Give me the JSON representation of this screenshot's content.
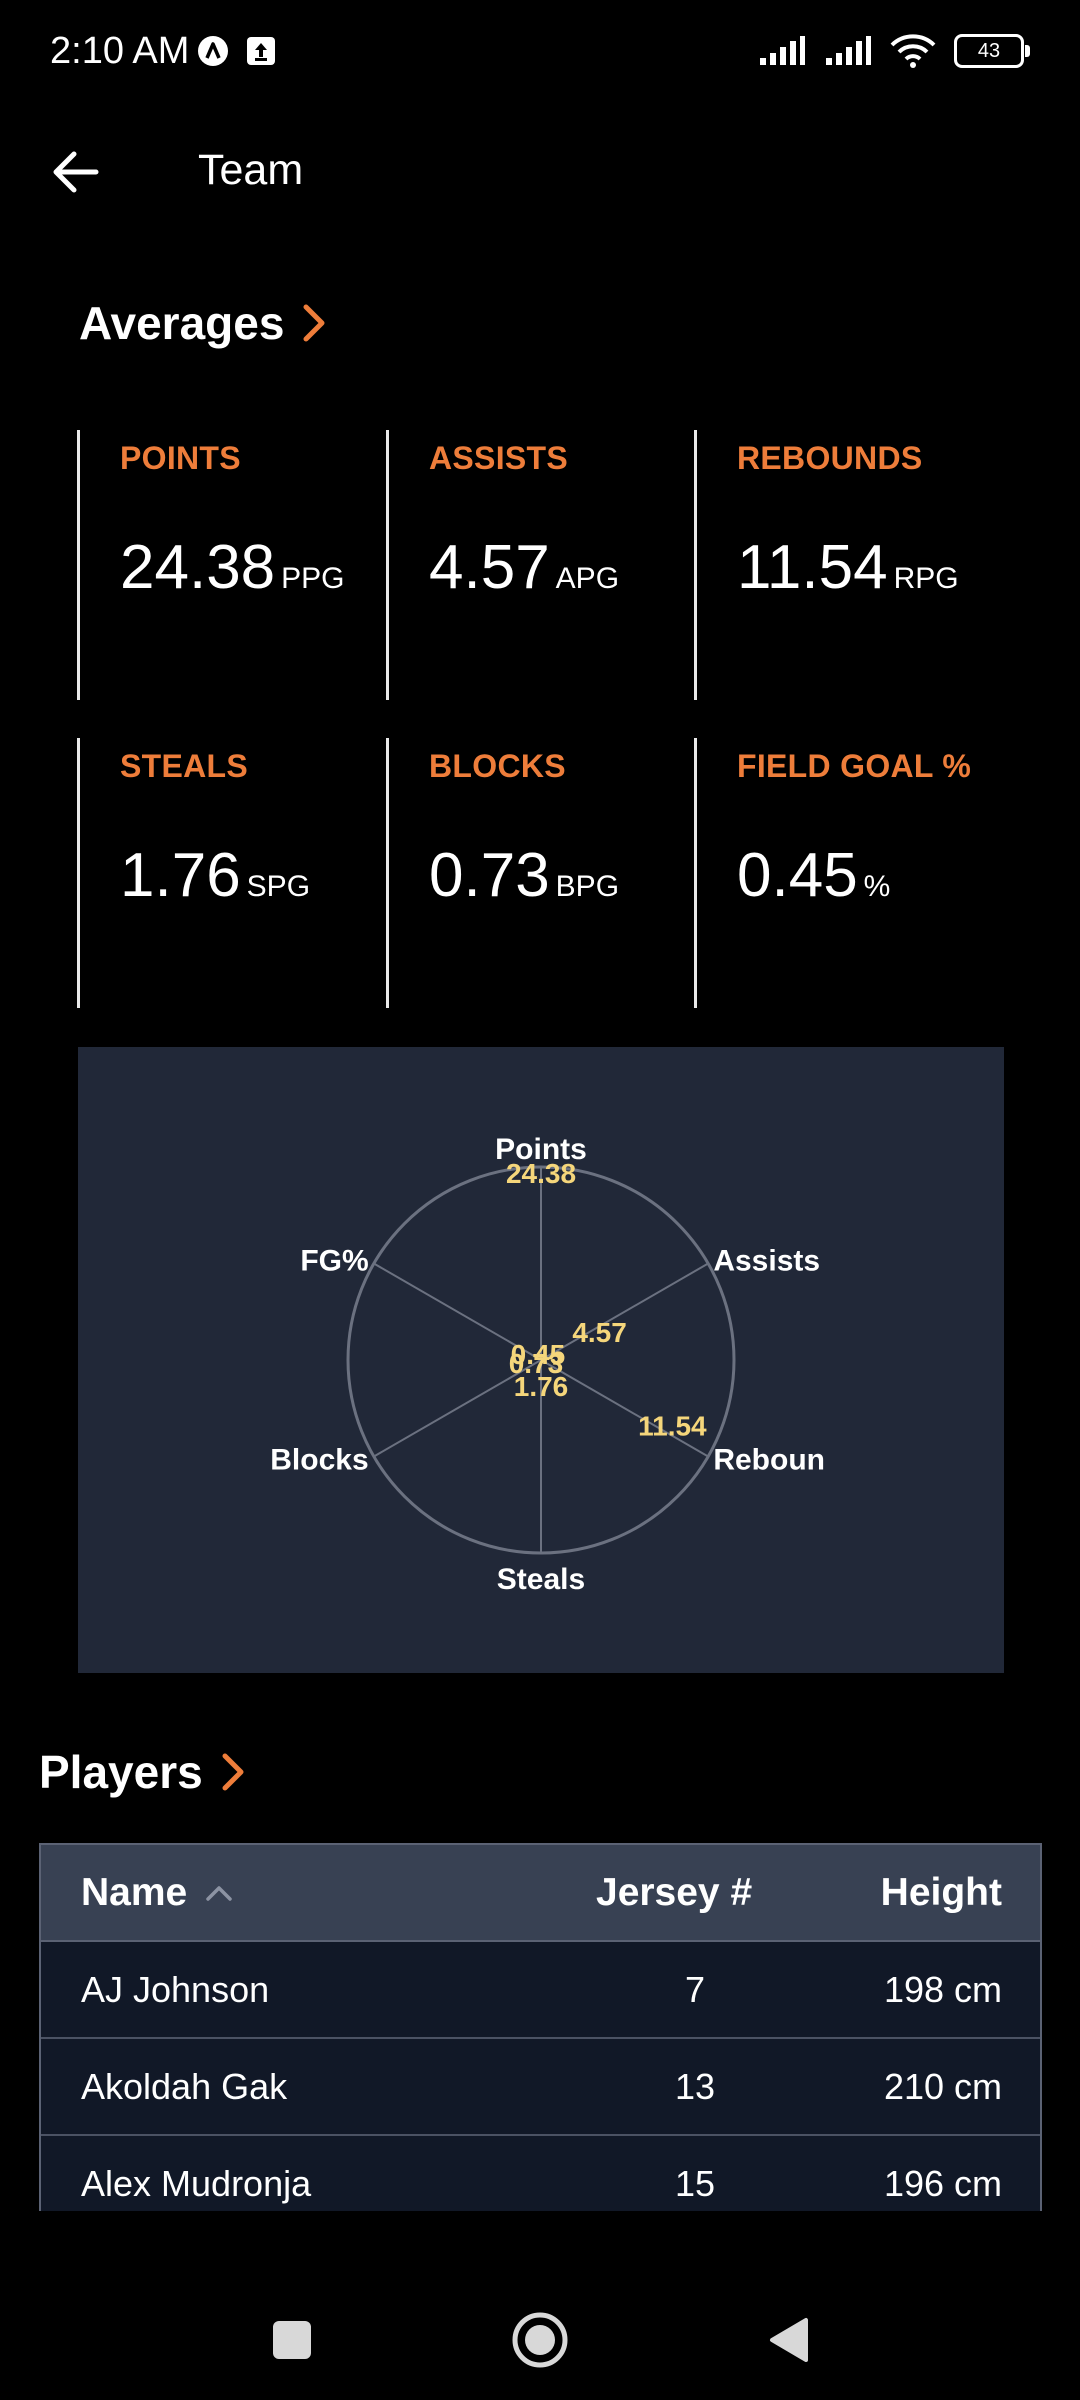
{
  "status": {
    "time": "2:10 AM",
    "battery": "43"
  },
  "header": {
    "title": "Team"
  },
  "averages": {
    "title": "Averages",
    "stats": [
      {
        "label": "POINTS",
        "value": "24.38",
        "unit": "PPG"
      },
      {
        "label": "ASSISTS",
        "value": "4.57",
        "unit": "APG"
      },
      {
        "label": "REBOUNDS",
        "value": "11.54",
        "unit": "RPG"
      },
      {
        "label": "STEALS",
        "value": "1.76",
        "unit": "SPG"
      },
      {
        "label": "BLOCKS",
        "value": "0.73",
        "unit": "BPG"
      },
      {
        "label": "FIELD GOAL %",
        "value": "0.45",
        "unit": "%"
      }
    ]
  },
  "chart_data": {
    "type": "radar",
    "axes": [
      "Points",
      "Assists",
      "Reboun",
      "Steals",
      "Blocks",
      "FG%"
    ],
    "values": [
      24.38,
      4.57,
      11.54,
      1.76,
      0.73,
      0.45
    ],
    "value_labels": [
      "24.38",
      "4.57",
      "11.54",
      "1.76",
      "0.73",
      "0.45"
    ],
    "rmax": 24.38,
    "colors": {
      "background": "#212838",
      "grid": "#6b7180",
      "value_text": "#f5d67b",
      "axis_text": "#ffffff"
    }
  },
  "players": {
    "title": "Players",
    "columns": [
      "Name",
      "Jersey #",
      "Height"
    ],
    "rows": [
      {
        "name": "AJ Johnson",
        "jersey": "7",
        "height": "198 cm"
      },
      {
        "name": "Akoldah Gak",
        "jersey": "13",
        "height": "210 cm"
      },
      {
        "name": "Alex Mudronja",
        "jersey": "15",
        "height": "196 cm"
      }
    ]
  },
  "colors": {
    "accent": "#ee7d3a",
    "background": "#000000"
  }
}
